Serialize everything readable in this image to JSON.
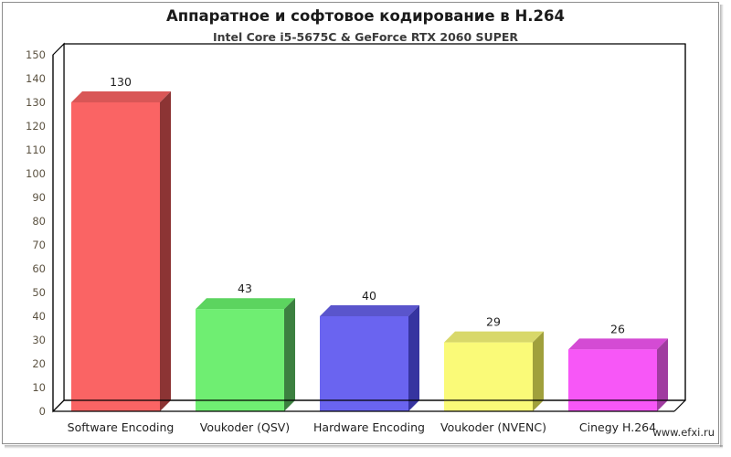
{
  "page": {
    "title": "Аппаратное и софтовое кодирование в H.264",
    "subtitle": "Intel Core i5-5675C & GeForce RTX 2060 SUPER",
    "watermark": "www.efxi.ru"
  },
  "chart_data": {
    "type": "bar",
    "title": "Аппаратное и софтовое кодирование в H.264",
    "subtitle": "Intel Core i5-5675C & GeForce RTX 2060 SUPER",
    "categories": [
      "Software Encoding",
      "Voukoder (QSV)",
      "Hardware Encoding",
      "Voukoder (NVENC)",
      "Cinegy H.264"
    ],
    "values": [
      130,
      43,
      40,
      29,
      26
    ],
    "data_labels": [
      "130",
      "43",
      "40",
      "29",
      "26"
    ],
    "colors": [
      "#fa6464",
      "#6fee72",
      "#6a64f0",
      "#fafa78",
      "#f757f7"
    ],
    "side_colors": [
      "#8c3434",
      "#3c8040",
      "#3634a0",
      "#a0a03c",
      "#a03ca0"
    ],
    "top_colors": [
      "#d95656",
      "#5cd45f",
      "#5a55cc",
      "#d8d86a",
      "#d44bd4"
    ],
    "xlabel": "",
    "ylabel": "",
    "ylim": [
      0,
      150
    ],
    "ytick_step": 10,
    "yticks": [
      "0",
      "10",
      "20",
      "30",
      "40",
      "50",
      "60",
      "70",
      "80",
      "90",
      "100",
      "110",
      "120",
      "130",
      "140",
      "150"
    ],
    "grid": false,
    "legend": false,
    "style_3d": true
  }
}
